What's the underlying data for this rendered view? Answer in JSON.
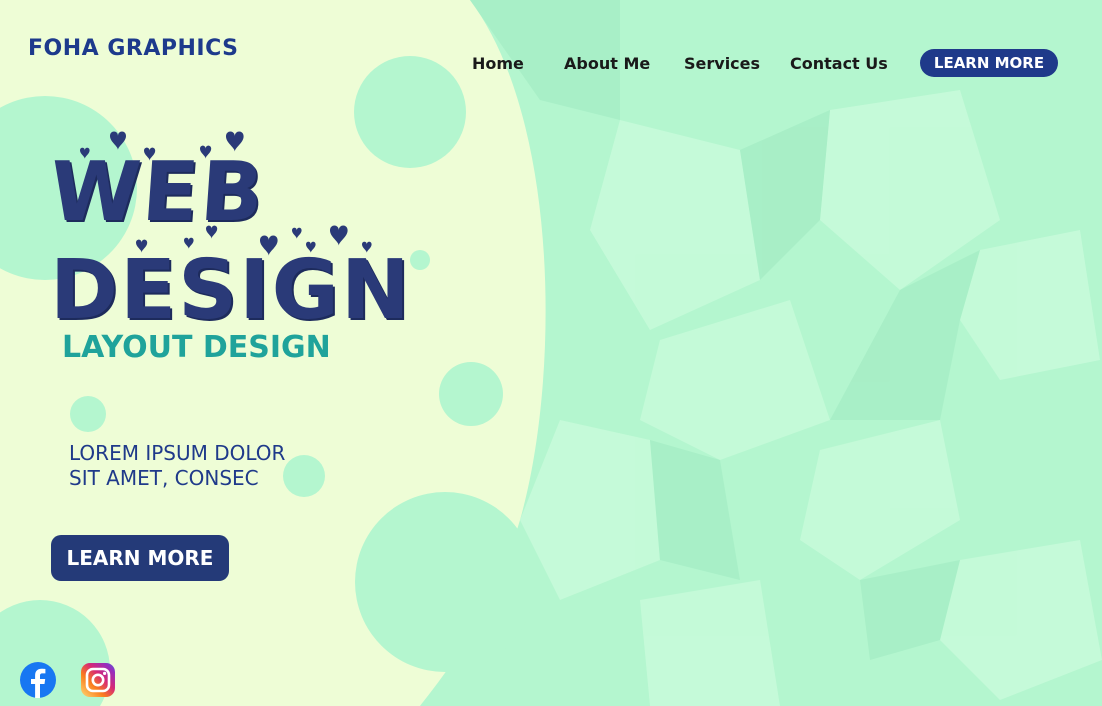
{
  "header": {
    "logo_text": "FOHA GRAPHICS",
    "nav": [
      "Home",
      "About Me",
      "Services",
      "Contact Us"
    ],
    "cta_label": "LEARN MORE"
  },
  "hero": {
    "title_line1": "WEB",
    "title_line2": "DESIGN",
    "subtitle": "LAYOUT DESIGN",
    "body": "LOREM IPSUM DOLOR SIT AMET, CONSEC",
    "cta_label": "LEARN MORE"
  },
  "social": [
    "facebook-icon",
    "instagram-icon"
  ],
  "colors": {
    "background": "#eefdd6",
    "accent_navy": "#1f3a8a",
    "teal": "#1fa39b",
    "mint": "#b2f5cf"
  }
}
